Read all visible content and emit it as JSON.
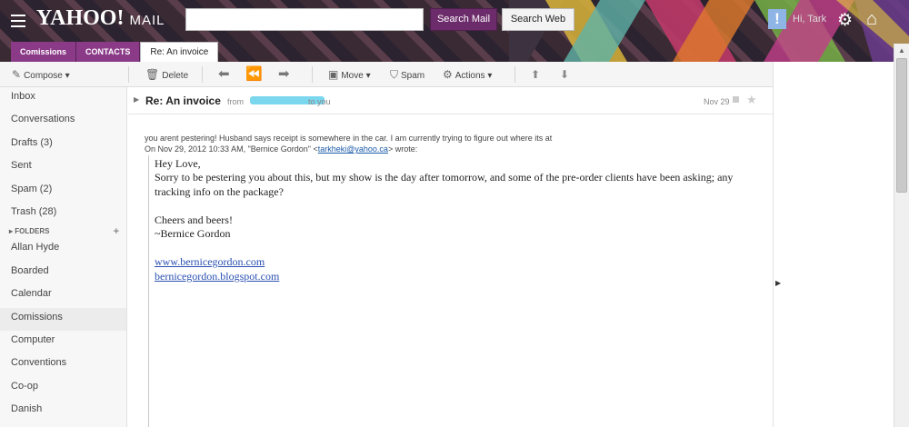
{
  "header": {
    "logo_text": "YAHOO!",
    "logo_suffix": "MAIL",
    "search_value": "",
    "search_mail_label": "Search Mail",
    "search_web_label": "Search Web",
    "user_greeting": "Hi, Tark"
  },
  "tabs": [
    {
      "label": "Comissions"
    },
    {
      "label": "CONTACTS"
    },
    {
      "label": "Re: An invoice"
    }
  ],
  "toolbar": {
    "compose": "Compose",
    "delete": "Delete",
    "move": "Move",
    "spam": "Spam",
    "actions": "Actions"
  },
  "sidebar": {
    "items": [
      {
        "label": "Inbox"
      },
      {
        "label": "Conversations"
      },
      {
        "label": "Drafts (3)"
      },
      {
        "label": "Sent"
      },
      {
        "label": "Spam (2)"
      },
      {
        "label": "Trash (28)"
      }
    ],
    "folders_header": "FOLDERS",
    "folders": [
      {
        "label": "Allan Hyde"
      },
      {
        "label": "Boarded"
      },
      {
        "label": "Calendar"
      },
      {
        "label": "Comissions"
      },
      {
        "label": "Computer"
      },
      {
        "label": "Conventions"
      },
      {
        "label": "Co-op"
      },
      {
        "label": "Danish"
      }
    ]
  },
  "message": {
    "subject": "Re: An invoice",
    "from_prefix": "from",
    "to_text": "to you",
    "date": "Nov 29",
    "reply_text": "you arent pestering! Husband says receipt is somewhere in the car. I am currently trying to figure out where its at",
    "quote_intro": "On Nov 29, 2012 10:33 AM, \"Bernice Gordon\" <",
    "quote_email": "tarkheki@yahoo.ca",
    "quote_outro": "> wrote:",
    "body": {
      "greeting": "Hey Love,",
      "line1": "Sorry to be pestering you about this, but my show is the day after tomorrow, and some of the pre-order clients have been asking; any",
      "line2": "tracking info on the package?",
      "signoff": "Cheers and beers!",
      "signature": "~Bernice Gordon",
      "link1": "www.bernicegordon.com",
      "link2": "bernicegordon.blogspot.com"
    }
  }
}
